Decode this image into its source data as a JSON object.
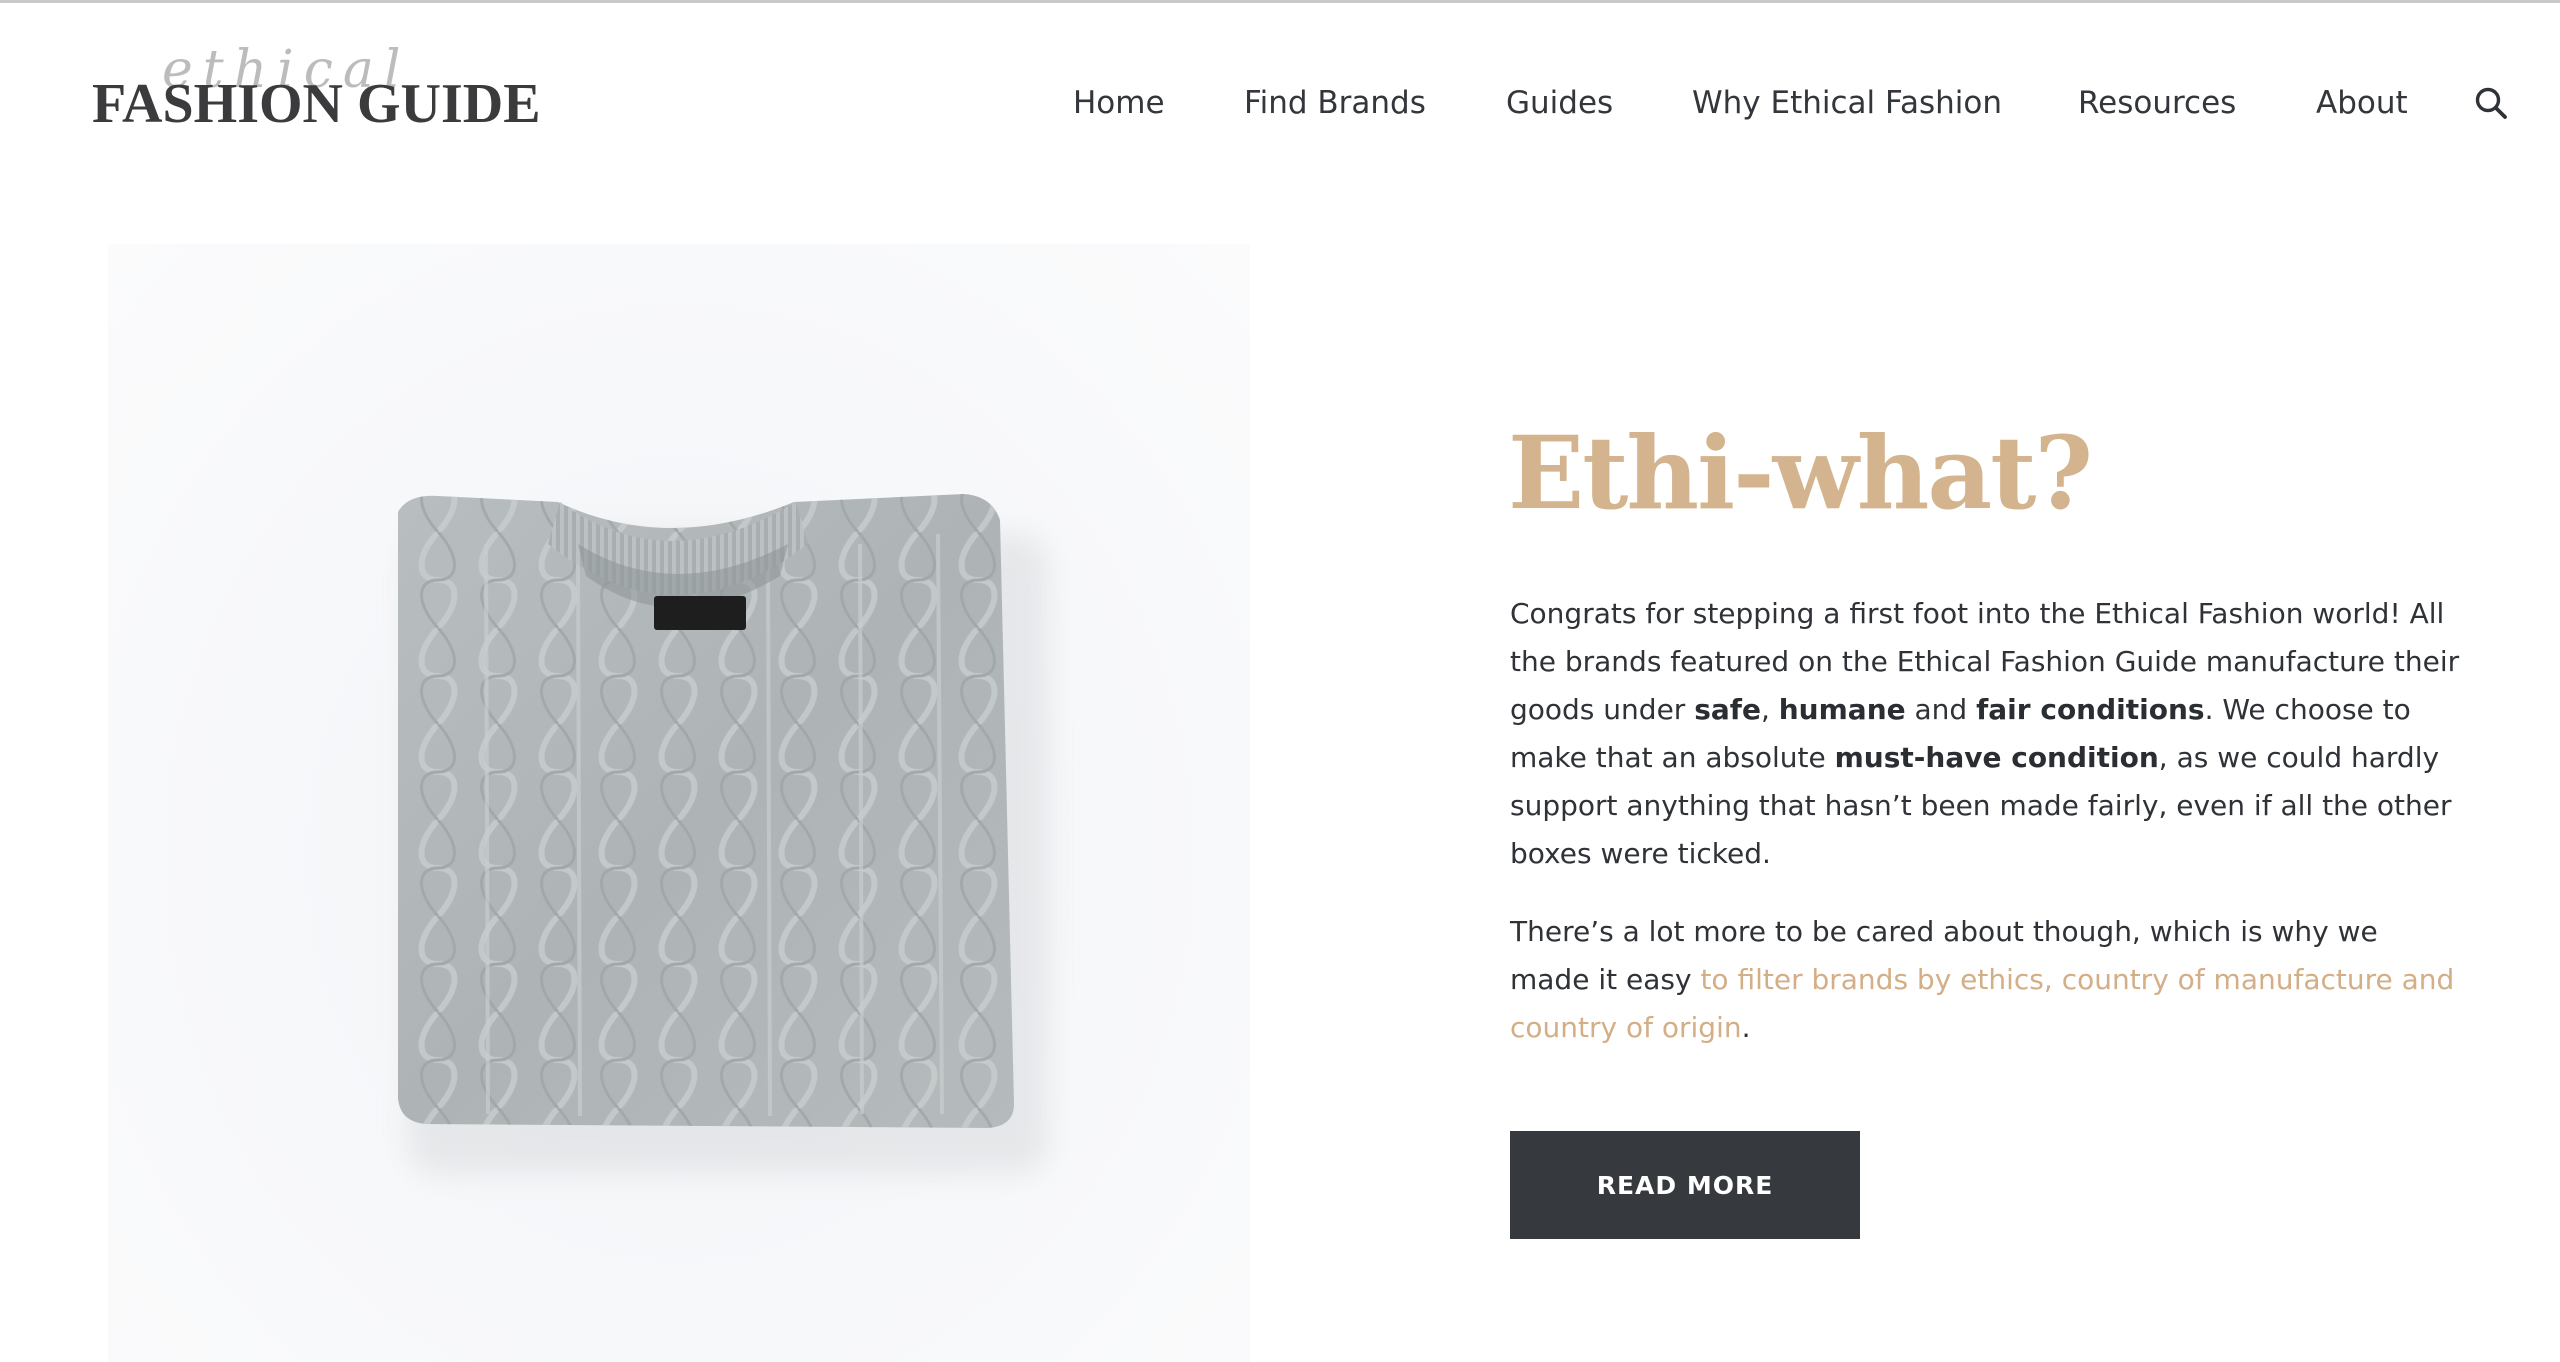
{
  "header": {
    "logo_script": "ethical",
    "logo_main": "FASHION GUIDE",
    "nav": [
      {
        "label": "Home"
      },
      {
        "label": "Find Brands"
      },
      {
        "label": "Guides"
      },
      {
        "label": "Why Ethical Fashion"
      },
      {
        "label": "Resources"
      },
      {
        "label": "About"
      }
    ],
    "search_icon": "search-icon"
  },
  "hero": {
    "image_subject": "grey cable-knit sweater folded on white background"
  },
  "content": {
    "headline": "Ethi-what?",
    "para1": {
      "t1": "Congrats for stepping a first foot into the Ethical Fashion world! All the brands featured on the Ethical Fashion Guide manufacture their goods under ",
      "b1": "safe",
      "t2": ", ",
      "b2": "humane",
      "t3": " and ",
      "b3": "fair conditions",
      "t4": ". We choose to make that an absolute ",
      "b4": "must-have condition",
      "t5": ", as we could hardly support anything that hasn’t been made fairly, even if all the other boxes were ticked."
    },
    "para2": {
      "t1": "There’s a lot more to be cared about though, which is why we made it easy ",
      "link": "to filter brands by ethics, country of manufacture and country of origin",
      "t2": "."
    },
    "read_more": "READ MORE"
  },
  "colors": {
    "accent": "#d4b48e",
    "link": "#d3ae86",
    "text": "#2f3237",
    "button_bg": "#36393e",
    "button_text": "#ffffff"
  }
}
